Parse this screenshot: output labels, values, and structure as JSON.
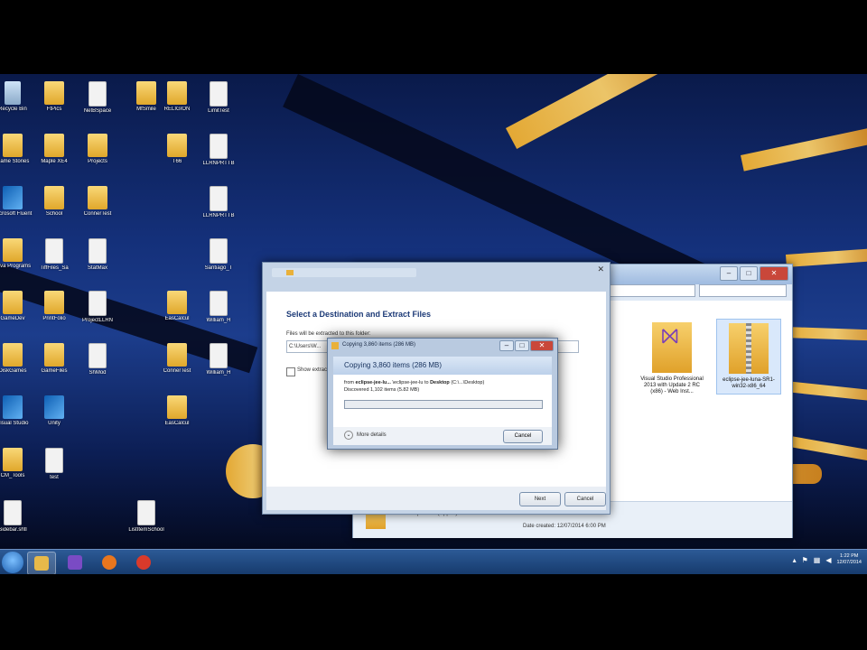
{
  "desktop_icons": [
    {
      "label": "Recycle Bin",
      "kind": "bin"
    },
    {
      "label": "FtPics",
      "kind": "folder"
    },
    {
      "label": "NetBSpace",
      "kind": "file"
    },
    {
      "label": "MfSmile",
      "kind": "folder"
    },
    {
      "label": "RELIGION",
      "kind": "folder"
    },
    {
      "label": "LimitTest",
      "kind": "file"
    },
    {
      "label": "Game Stories",
      "kind": "folder"
    },
    {
      "label": "Maple XE4",
      "kind": "folder"
    },
    {
      "label": "Projects",
      "kind": "folder"
    },
    {
      "label": "T66",
      "kind": "folder"
    },
    {
      "label": "LLRNPRTTB",
      "kind": "file"
    },
    {
      "label": "Microsoft Fluent",
      "kind": "app"
    },
    {
      "label": "School",
      "kind": "folder"
    },
    {
      "label": "ConnerTest",
      "kind": "folder"
    },
    {
      "label": "LLRNPRTTB",
      "kind": "file"
    },
    {
      "label": "Java Programs",
      "kind": "folder"
    },
    {
      "label": "TiffFiles_Sa",
      "kind": "file"
    },
    {
      "label": "EasCalcul",
      "kind": "folder"
    },
    {
      "label": "Santiago_T",
      "kind": "file"
    },
    {
      "label": "GameDev",
      "kind": "folder"
    },
    {
      "label": "PrintFolio",
      "kind": "folder"
    },
    {
      "label": "StatMax",
      "kind": "file"
    },
    {
      "label": "William_H",
      "kind": "file"
    },
    {
      "label": "DiskGames",
      "kind": "folder"
    },
    {
      "label": "GameFiles",
      "kind": "folder"
    },
    {
      "label": "ConnerTest",
      "kind": "folder"
    },
    {
      "label": "William_H",
      "kind": "file"
    },
    {
      "label": "Visual Studio",
      "kind": "app"
    },
    {
      "label": "Unity",
      "kind": "app"
    },
    {
      "label": "ProjectLLRN",
      "kind": "file"
    },
    {
      "label": "EasCalcul",
      "kind": "folder"
    },
    {
      "label": "CM_Tools",
      "kind": "folder"
    },
    {
      "label": "test",
      "kind": "file"
    },
    {
      "label": "ShMod",
      "kind": "file"
    },
    {
      "label": "Sidebar.shtl",
      "kind": "file"
    },
    {
      "label": "ListItemSchool",
      "kind": "file"
    },
    {
      "label": "Anime",
      "kind": "folder"
    }
  ],
  "explorer": {
    "files": [
      {
        "name": "Visual Studio Professional 2013 with Update 2 RC (x86) - Web Inst...",
        "icon": "vs-folder-icon"
      },
      {
        "name": "eclipse-jee-luna-SR1-win32-x86_64",
        "icon": "zip-folder-icon"
      }
    ],
    "status_type": "Compressed (zipped) Folder",
    "status_date": "Date created: 12/07/2014 6:00 PM"
  },
  "wizard": {
    "heading": "Select a Destination and Extract Files",
    "sub_label": "Files will be extracted to this folder:",
    "path_value": "C:\\Users\\W...",
    "checkbox_label": "Show extracted files when complete",
    "next_label": "Next",
    "cancel_label": "Cancel"
  },
  "copy_dialog": {
    "title": "Copying 3,860 items (286 MB)",
    "headline": "Copying 3,860 items (286 MB)",
    "from_prefix": "from",
    "from_bold": "eclipse-jee-lu...",
    "from_mid": "\\eclipse-jee-lu to",
    "to_bold": "Desktop",
    "to_path": "(C:\\...\\Desktop)",
    "discovered": "Discovered 1,102 items (5.82 MB)",
    "progress": 0.0,
    "more_details": "More details",
    "cancel_label": "Cancel"
  },
  "taskbar": {
    "apps": [
      {
        "name": "explorer",
        "color": "#e7b94a",
        "active": true
      },
      {
        "name": "visual-studio",
        "color": "#7a4bc4",
        "active": false
      },
      {
        "name": "firefox",
        "color": "#e8761e",
        "active": false
      },
      {
        "name": "recorder",
        "color": "#d93a2b",
        "active": false
      }
    ],
    "time": "1:22 PM",
    "date": "12/07/2014"
  }
}
